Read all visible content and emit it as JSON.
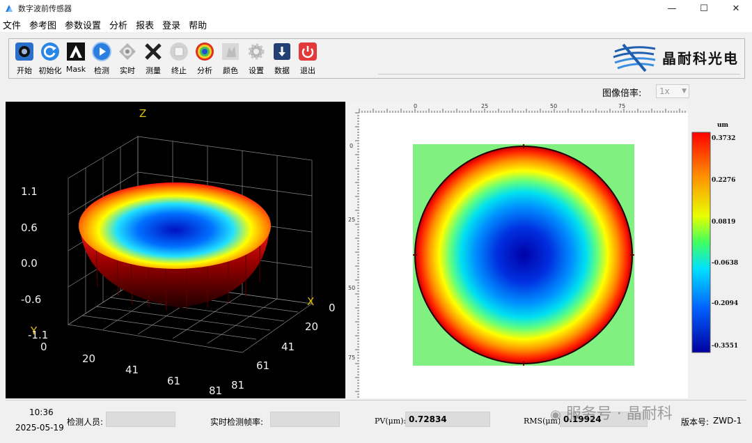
{
  "window": {
    "title": "数字波前传感器",
    "min": "—",
    "max": "☐",
    "close": "✕"
  },
  "menu": [
    "文件",
    "参考图",
    "参数设置",
    "分析",
    "报表",
    "登录",
    "帮助"
  ],
  "toolbar": {
    "buttons": [
      {
        "label": "开始",
        "icon": "camera-icon",
        "color": "#1f6fd1"
      },
      {
        "label": "初始化",
        "icon": "refresh-icon",
        "color": "#2a86e6"
      },
      {
        "label": "Mask",
        "icon": "mask-icon",
        "color": "#111111"
      },
      {
        "label": "检测",
        "icon": "play-icon",
        "color": "#2b7fe0"
      },
      {
        "label": "实时",
        "icon": "realtime-icon",
        "color": "#9a9a9a"
      },
      {
        "label": "测量",
        "icon": "cross-icon",
        "color": "#222222"
      },
      {
        "label": "终止",
        "icon": "stop-icon",
        "color": "#b9b9b9"
      },
      {
        "label": "分析",
        "icon": "analysis-icon",
        "color": "#e05a20"
      },
      {
        "label": "颜色",
        "icon": "color-icon",
        "color": "#c0c0c0"
      },
      {
        "label": "设置",
        "icon": "gear-icon",
        "color": "#b0b0b0"
      },
      {
        "label": "数据",
        "icon": "download-icon",
        "color": "#2a4a80"
      },
      {
        "label": "退出",
        "icon": "power-icon",
        "color": "#e23a3a"
      }
    ],
    "logo_text": "晶耐科光电"
  },
  "zoom": {
    "label": "图像倍率:",
    "value": "1x"
  },
  "view3d": {
    "axis_z": "Z",
    "axis_x": "X",
    "axis_y": "Y",
    "z_ticks": [
      "1.1",
      "0.6",
      "0.0",
      "-0.6",
      "-1.1"
    ],
    "x_ticks": [
      "0",
      "20",
      "41",
      "61",
      "81"
    ],
    "y_ticks": [
      "0",
      "20",
      "41",
      "61",
      "81"
    ]
  },
  "map": {
    "top_ruler": [
      "0",
      "25",
      "50",
      "75"
    ],
    "left_ruler": [
      "0",
      "25",
      "50",
      "75"
    ]
  },
  "colorbar": {
    "unit": "um",
    "ticks": [
      "0.3732",
      "0.2276",
      "0.0819",
      "-0.0638",
      "-0.2094",
      "-0.3551"
    ]
  },
  "status": {
    "time": "10:36",
    "date": "2025-05-19",
    "inspector_label": "检测人员:",
    "inspector_value": "",
    "framerate_label": "实时检测帧率:",
    "framerate_value": "",
    "pv_label": "PV(μm):",
    "pv_value": "0.72834",
    "rms_label": "RMS(μm):",
    "rms_value": "0.19924",
    "version_label": "版本号:",
    "version_value": "ZWD-1"
  },
  "watermark": "服务号 · 晶耐科"
}
